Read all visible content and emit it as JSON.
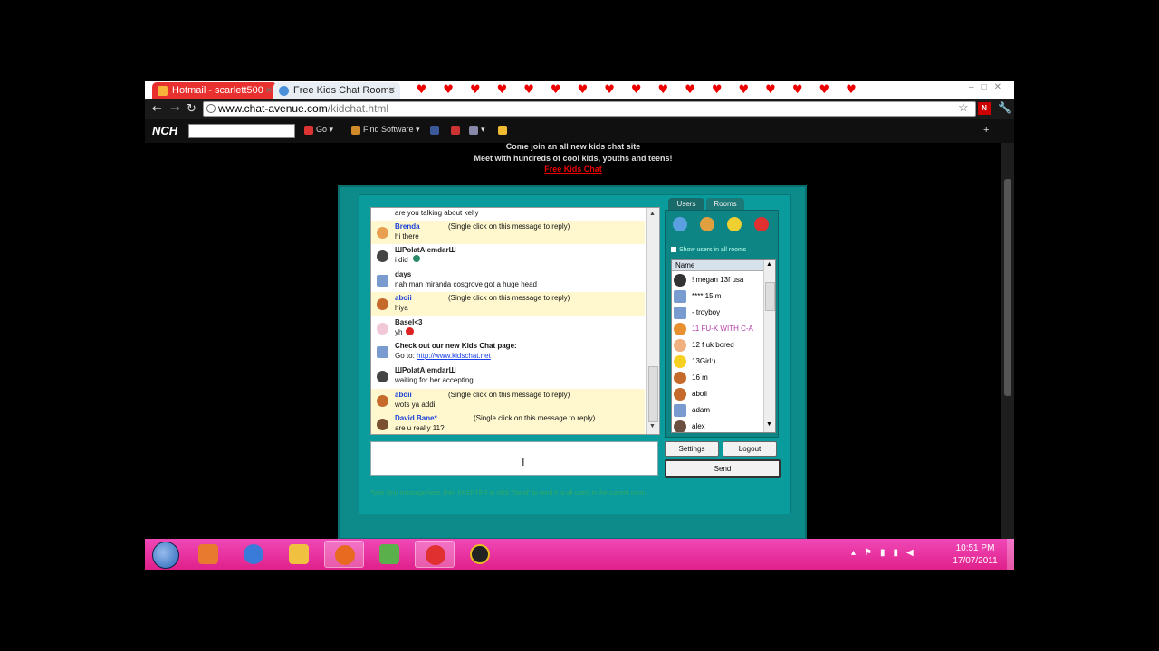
{
  "browser": {
    "tabs": [
      {
        "label": "Hotmail - scarlett500"
      },
      {
        "label": "Free Kids Chat Rooms"
      }
    ],
    "address": {
      "host": "www.chat-avenue.com",
      "path": "/kidchat.html"
    }
  },
  "nch_toolbar": {
    "logo": "NCH",
    "go_label": "Go",
    "find_software_label": "Find Software"
  },
  "page": {
    "promo_line1": "Come join an all new kids chat site",
    "promo_line2": "Meet with hundreds of cool kids, youths and teens!",
    "promo_link": "Free Kids Chat"
  },
  "chat": {
    "messages": [
      {
        "name": "",
        "text": "are you talking about kelly",
        "hl": false
      },
      {
        "name": "Brenda",
        "text": "hi there",
        "reply": "(Single click on this message to reply)",
        "hl": true
      },
      {
        "name": "ШPolatAlemdarШ",
        "text": "i did",
        "hl": false
      },
      {
        "name": "days",
        "text": "nah man miranda cosgrove got a huge head",
        "hl": false
      },
      {
        "name": "aboii",
        "text": "hiya",
        "reply": "(Single click on this message to reply)",
        "hl": true
      },
      {
        "name": "Basel<3",
        "text": "yh",
        "hl": false
      },
      {
        "name": "Check out our new Kids Chat page:",
        "text": "Go to: ",
        "link": "http://www.kidschat.net",
        "hl": false
      },
      {
        "name": "ШPolatAlemdarШ",
        "text": "waiting for her accepting",
        "hl": false
      },
      {
        "name": "aboii",
        "text": "wots ya addi",
        "reply": "(Single click on this message to reply)",
        "hl": true
      },
      {
        "name": "David Bane*",
        "text": "are u really 11?",
        "reply": "(Single click on this message to reply)",
        "hl": true
      }
    ],
    "tabs": {
      "users": "Users",
      "rooms": "Rooms"
    },
    "show_all_label": "Show users in all rooms",
    "list_header": "Name",
    "users": [
      {
        "name": "! megan 13f usa",
        "color": "#111111"
      },
      {
        "name": "**** 15 m",
        "color": "#111111"
      },
      {
        "name": "- troyboy",
        "color": "#111111"
      },
      {
        "name": "11 FU-K WITH C-A",
        "color": "#b03aa8"
      },
      {
        "name": "12 f uk bored",
        "color": "#111111"
      },
      {
        "name": "13Girl:)",
        "color": "#111111"
      },
      {
        "name": "16 m",
        "color": "#111111"
      },
      {
        "name": "aboii",
        "color": "#111111"
      },
      {
        "name": "adam",
        "color": "#111111"
      },
      {
        "name": "alex",
        "color": "#111111"
      }
    ],
    "settings_label": "Settings",
    "logout_label": "Logout",
    "send_label": "Send",
    "hint": "Type your message here, then hit ENTER or click \"Send\" to send it to all users in the current room."
  },
  "taskbar": {
    "time": "10:51 PM",
    "date": "17/07/2011"
  }
}
